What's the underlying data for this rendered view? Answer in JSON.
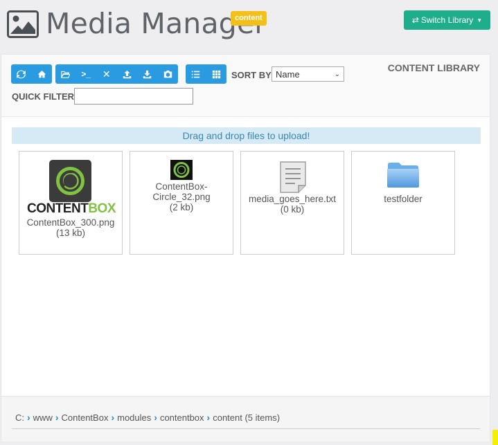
{
  "header": {
    "title": "Media Manager",
    "icon": "image-icon",
    "badge": "content",
    "switch_button": "Switch Library",
    "switch_icon": "exchange-icon"
  },
  "toolbar": {
    "group1": [
      "refresh-icon",
      "home-icon"
    ],
    "group2": [
      "folder-open-icon",
      "terminal-icon",
      "delete-icon",
      "upload-icon",
      "download-icon",
      "camera-icon"
    ],
    "group3": [
      "list-view-icon",
      "grid-view-icon"
    ],
    "sort_label": "SORT BY",
    "sort_value": "Name",
    "library_label": "CONTENT LIBRARY",
    "filter_label": "QUICK FILTER",
    "filter_value": ""
  },
  "dropzone": "Drag and drop files to upload!",
  "files": [
    {
      "name": "ContentBox_300.png",
      "size": "(13 kb)",
      "logo_text_a": "CONTENT",
      "logo_text_b": "BOX"
    },
    {
      "name_line1": "ContentBox-",
      "name_line2": "Circle_32.png",
      "size": "(2 kb)"
    },
    {
      "name": "media_goes_here.txt",
      "size": "(0 kb)"
    },
    {
      "name": "testfolder"
    }
  ],
  "breadcrumb": {
    "items": [
      "C:",
      "www",
      "ContentBox",
      "modules",
      "contentbox",
      "content (5 items)"
    ]
  },
  "colors": {
    "primary": "#2a9be0",
    "success": "#1fae8c",
    "warning": "#f4c017",
    "contentbox_green": "#80c242"
  }
}
